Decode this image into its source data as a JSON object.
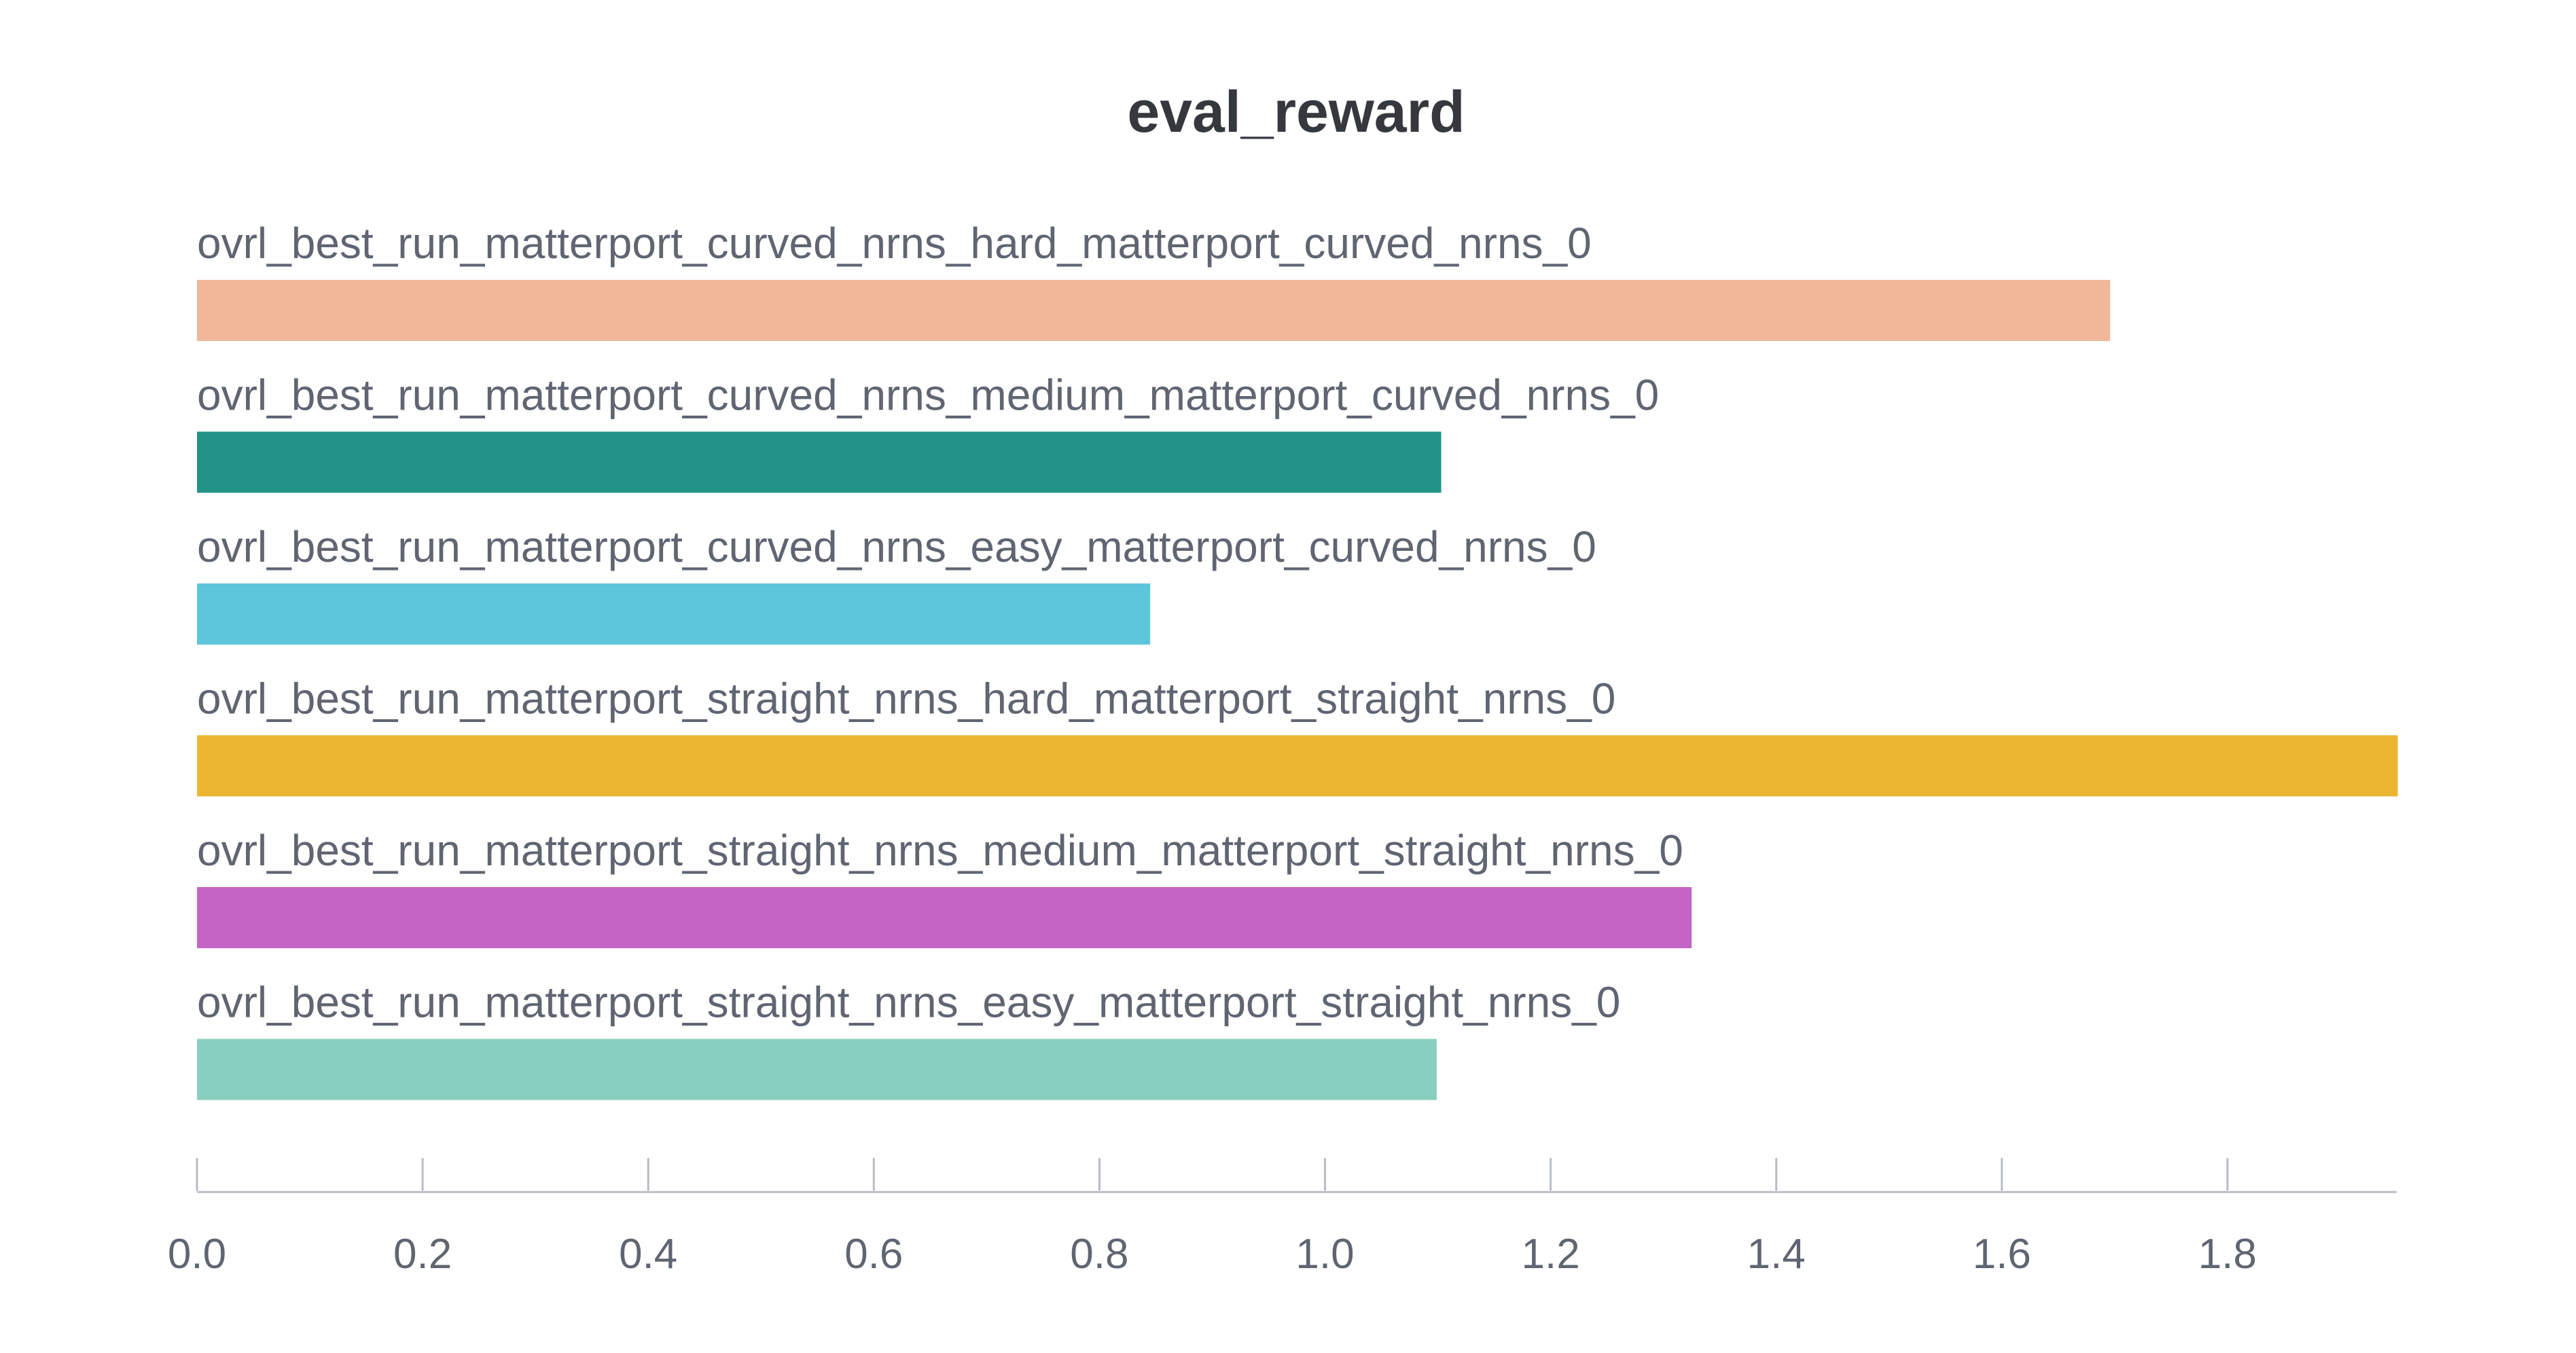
{
  "chart_data": {
    "type": "bar",
    "orientation": "horizontal",
    "title": "eval_reward",
    "xlabel": "",
    "ylabel": "",
    "xlim": [
      0,
      1.95
    ],
    "grid": false,
    "legend": "none",
    "categories": [
      "ovrl_best_run_matterport_curved_nrns_hard_matterport_curved_nrns_0",
      "ovrl_best_run_matterport_curved_nrns_medium_matterport_curved_nrns_0",
      "ovrl_best_run_matterport_curved_nrns_easy_matterport_curved_nrns_0",
      "ovrl_best_run_matterport_straight_nrns_hard_matterport_straight_nrns_0",
      "ovrl_best_run_matterport_straight_nrns_medium_matterport_straight_nrns_0",
      "ovrl_best_run_matterport_straight_nrns_easy_matterport_straight_nrns_0"
    ],
    "values": [
      1.696,
      1.103,
      0.845,
      1.951,
      1.325,
      1.099
    ],
    "colors": [
      "#f0b799",
      "#229487",
      "#5dc6da",
      "#ebb632",
      "#c465c5",
      "#89cfbf"
    ],
    "x_ticks": [
      "0.0",
      "0.2",
      "0.4",
      "0.6",
      "0.8",
      "1.0",
      "1.2",
      "1.4",
      "1.6",
      "1.8"
    ]
  }
}
